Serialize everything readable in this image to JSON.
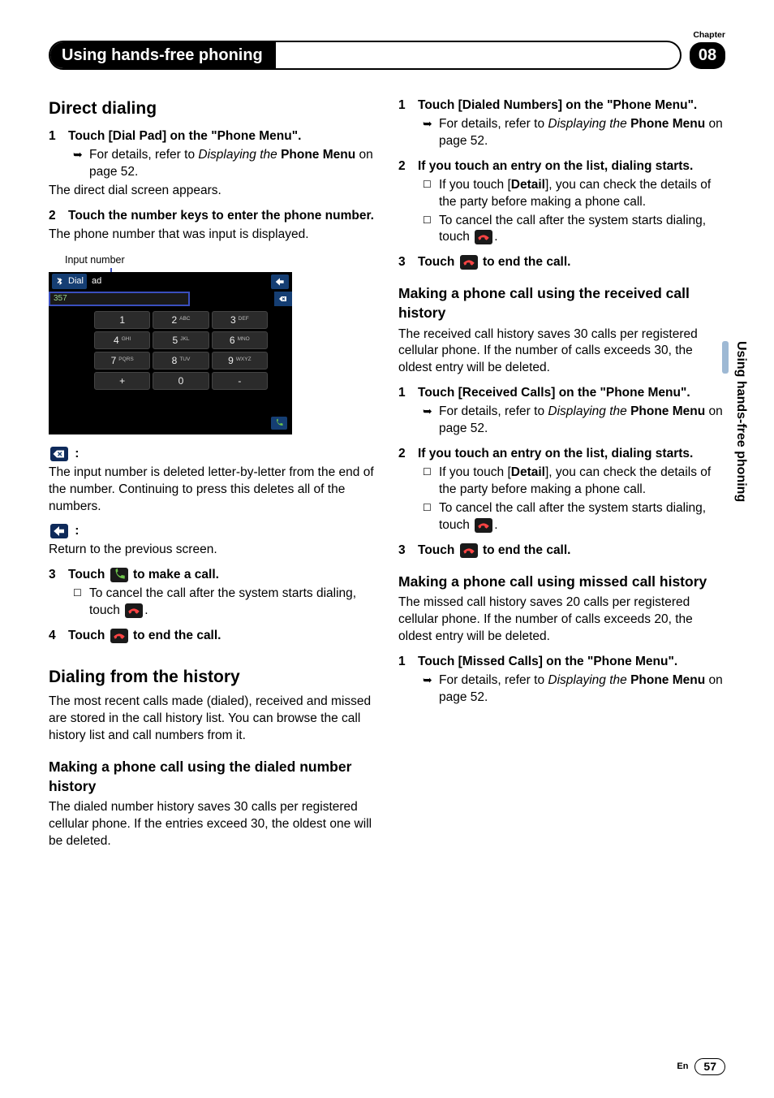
{
  "header": {
    "chapter_label": "Chapter",
    "chapter_number": "08",
    "title": "Using hands-free phoning"
  },
  "sidetab": "Using hands-free phoning",
  "col_left": {
    "direct_dialing": {
      "heading": "Direct dialing",
      "step1": "Touch [Dial Pad] on the \"Phone Menu\".",
      "step1_detail_a": "For details, refer to ",
      "step1_detail_b": "Displaying the ",
      "step1_detail_c": "Phone Menu",
      "step1_detail_d": " on page 52.",
      "step1_result": "The direct dial screen appears.",
      "step2": "Touch the number keys to enter the phone number.",
      "step2_result": "The phone number that was input is displayed.",
      "illus_label": "Input number",
      "dialpad": {
        "top_dial": "Dial",
        "top_pad": "ad",
        "current_number": "357",
        "keys": [
          {
            "big": "1",
            "sm": ""
          },
          {
            "big": "2",
            "sm": "ABC"
          },
          {
            "big": "3",
            "sm": "DEF"
          },
          {
            "big": "4",
            "sm": "GHI"
          },
          {
            "big": "5",
            "sm": "JKL"
          },
          {
            "big": "6",
            "sm": "MNO"
          },
          {
            "big": "7",
            "sm": "PQRS"
          },
          {
            "big": "8",
            "sm": "TUV"
          },
          {
            "big": "9",
            "sm": "WXYZ"
          },
          {
            "big": "+",
            "sm": ""
          },
          {
            "big": "0",
            "sm": ""
          },
          {
            "big": "-",
            "sm": ""
          }
        ]
      },
      "icon_del_desc": "The input number is deleted letter-by-letter from the end of the number. Continuing to press this deletes all of the numbers.",
      "icon_back_desc": "Return to the previous screen.",
      "step3_a": "Touch ",
      "step3_b": " to make a call.",
      "step3_note": "To cancel the call after the system starts dialing, touch ",
      "step4_a": "Touch ",
      "step4_b": " to end the call."
    },
    "history": {
      "heading": "Dialing from the history",
      "intro": "The most recent calls made (dialed), received and missed are stored in the call history list. You can browse the call history list and call numbers from it.",
      "dialed_sub": "Making a phone call using the dialed number history",
      "dialed_intro": "The dialed number history saves 30 calls per registered cellular phone. If the entries exceed 30, the oldest one will be deleted."
    }
  },
  "col_right": {
    "dialed": {
      "step1": "Touch [Dialed Numbers] on the \"Phone Menu\".",
      "step1_detail_a": "For details, refer to ",
      "step1_detail_b": "Displaying the ",
      "step1_detail_c": "Phone Menu",
      "step1_detail_d": " on page 52.",
      "step2": "If you touch an entry on the list, dialing starts.",
      "step2_note1_a": "If you touch [",
      "step2_note1_b": "Detail",
      "step2_note1_c": "], you can check the details of the party before making a phone call.",
      "step2_note2": "To cancel the call after the system starts dialing, touch ",
      "step3_a": "Touch ",
      "step3_b": " to end the call."
    },
    "received": {
      "heading": "Making a phone call using the received call history",
      "intro": "The received call history saves 30 calls per registered cellular phone. If the number of calls exceeds 30, the oldest entry will be deleted.",
      "step1": "Touch [Received Calls] on the \"Phone Menu\".",
      "step1_detail_a": "For details, refer to ",
      "step1_detail_b": "Displaying the ",
      "step1_detail_c": "Phone Menu",
      "step1_detail_d": " on page 52.",
      "step2": "If you touch an entry on the list, dialing starts.",
      "step2_note1_a": "If you touch [",
      "step2_note1_b": "Detail",
      "step2_note1_c": "], you can check the details of the party before making a phone call.",
      "step2_note2": "To cancel the call after the system starts dialing, touch ",
      "step3_a": "Touch ",
      "step3_b": " to end the call."
    },
    "missed": {
      "heading": "Making a phone call using missed call history",
      "intro": "The missed call history saves 20 calls per registered cellular phone. If the number of calls exceeds 20, the oldest entry will be deleted.",
      "step1": "Touch [Missed Calls] on the \"Phone Menu\".",
      "step1_detail_a": "For details, refer to ",
      "step1_detail_b": "Displaying the ",
      "step1_detail_c": "Phone Menu",
      "step1_detail_d": " on page 52."
    }
  },
  "footer": {
    "lang": "En",
    "page": "57"
  }
}
